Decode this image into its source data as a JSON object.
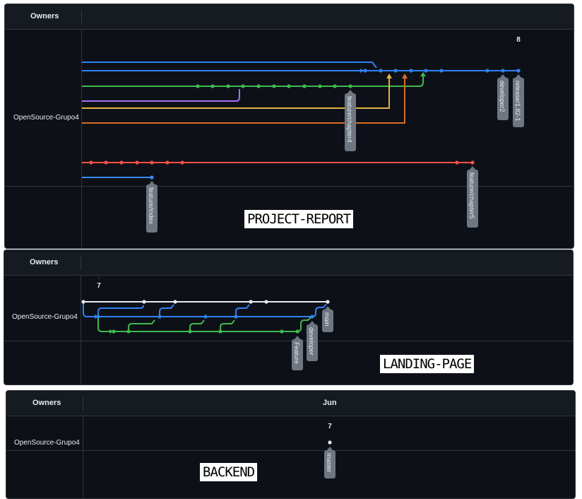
{
  "colors": {
    "bg": "#0d1117",
    "header_bg": "#161b22",
    "border": "#30363d",
    "text": "#e6edf3",
    "tag_bg": "#6e7681",
    "blue": "#2f81f7",
    "green": "#3fb950",
    "purple": "#a371f7",
    "yellow": "#e3b341",
    "orange": "#db6d28",
    "red": "#f85149",
    "white": "#e6edf3",
    "steel": "#388bfd"
  },
  "panels": [
    {
      "header": {
        "owners_label": "Owners",
        "date_label": ""
      },
      "owner": "OpenSource-Grupo4",
      "day_label": "8",
      "branch_tags": [
        "developer2",
        "release/1.82-1",
        "feature/chapter4",
        "feature/chapter5",
        "feature/index"
      ],
      "caption": "PROJECT-REPORT"
    },
    {
      "header": {
        "owners_label": "Owners",
        "date_label": ""
      },
      "owner": "OpenSource-Grupo4",
      "day_label": "7",
      "branch_tags": [
        "main",
        "developer",
        "Feature"
      ],
      "caption": "LANDING-PAGE"
    },
    {
      "header": {
        "owners_label": "Owners",
        "date_label": "Jun"
      },
      "owner": "OpenSource-Grupo4",
      "day_label": "7",
      "branch_tags": [
        "master"
      ],
      "caption": "BACKEND"
    }
  ]
}
